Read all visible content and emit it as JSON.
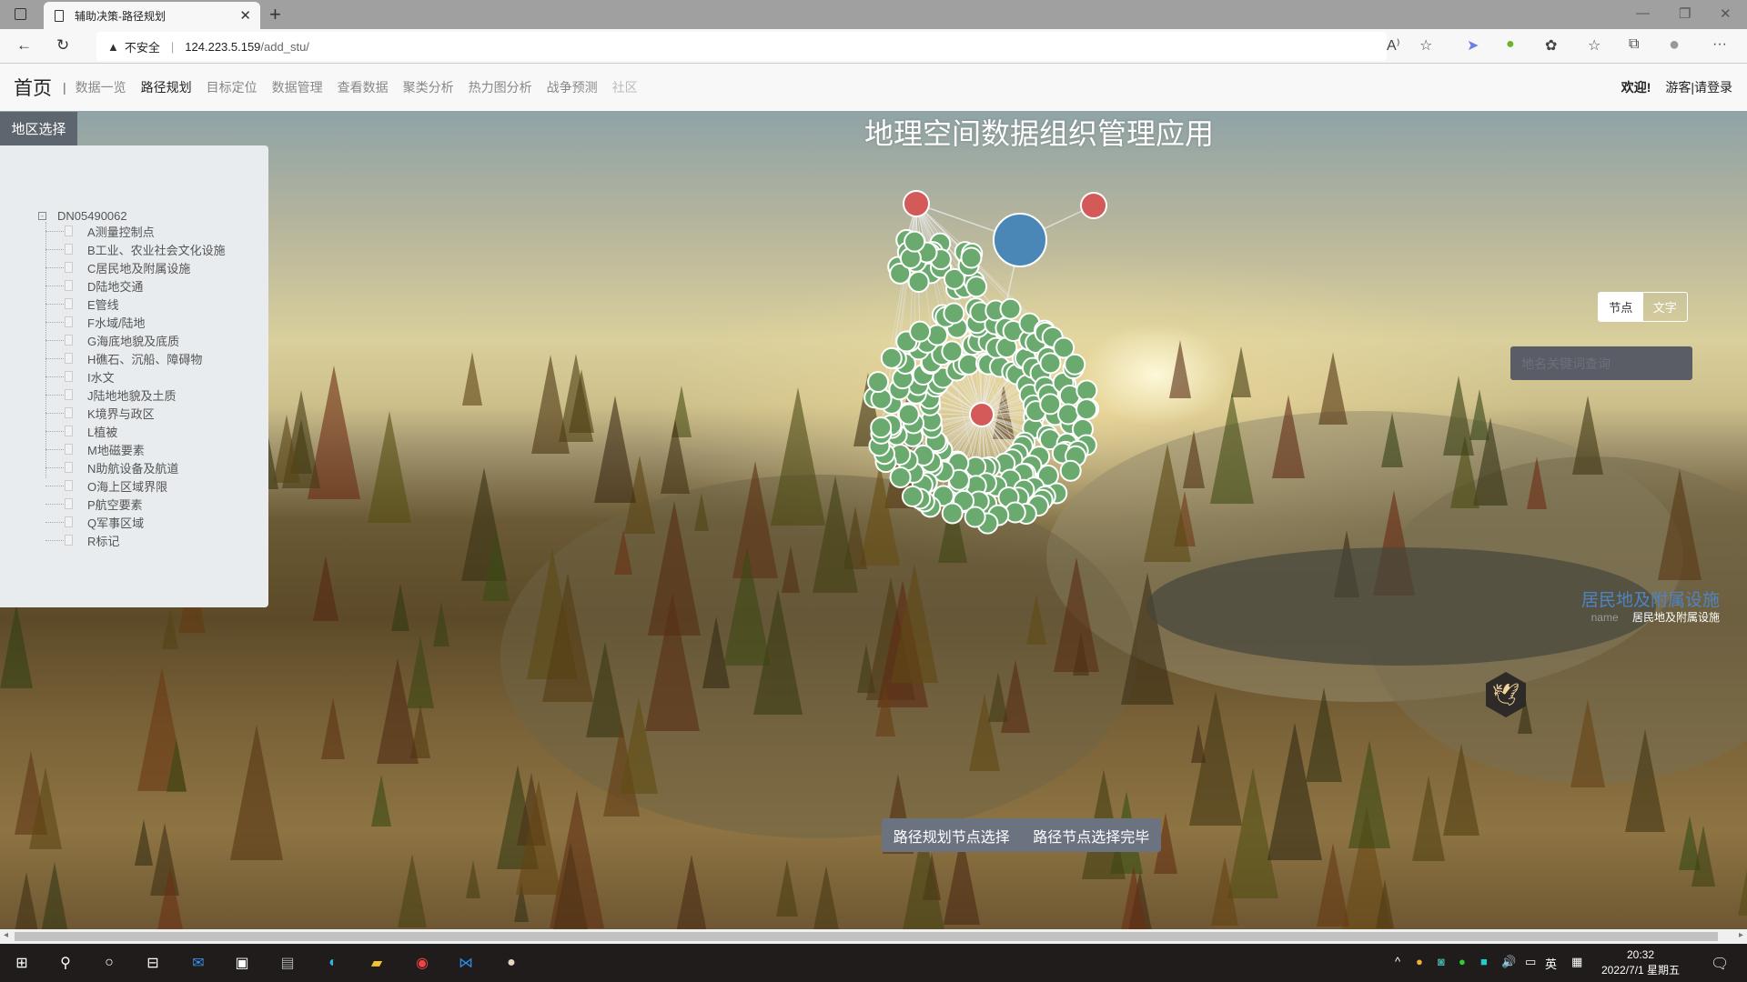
{
  "browser": {
    "tab_title": "辅助决策-路径规划",
    "security_label": "不安全",
    "url_host": "124.223.5.159",
    "url_path": "/add_stu/"
  },
  "nav": {
    "home": "首页",
    "separator": "|",
    "items": [
      {
        "label": "数据一览",
        "state": "normal"
      },
      {
        "label": "路径规划",
        "state": "active"
      },
      {
        "label": "目标定位",
        "state": "normal"
      },
      {
        "label": "数据管理",
        "state": "normal"
      },
      {
        "label": "查看数据",
        "state": "normal"
      },
      {
        "label": "聚类分析",
        "state": "normal"
      },
      {
        "label": "热力图分析",
        "state": "normal"
      },
      {
        "label": "战争预测",
        "state": "normal"
      },
      {
        "label": "社区",
        "state": "dim"
      }
    ],
    "welcome": "欢迎!",
    "login": "游客|请登录"
  },
  "page": {
    "title": "地理空间数据组织管理应用",
    "region_label": "地区选择",
    "tree": {
      "root": "DN05490062",
      "items": [
        "A测量控制点",
        "B工业、农业社会文化设施",
        "C居民地及附属设施",
        "D陆地交通",
        "E管线",
        "F水域/陆地",
        "G海底地貌及底质",
        "H礁石、沉船、障碍物",
        "I水文",
        "J陆地地貌及土质",
        "K境界与政区",
        "L植被",
        "M地磁要素",
        "N助航设备及航道",
        "O海上区域界限",
        "P航空要素",
        "Q军事区域",
        "R标记"
      ]
    },
    "toggle": {
      "node": "节点",
      "text": "文字",
      "selected": "节点"
    },
    "search_placeholder": "地名关键词查询",
    "info": {
      "title": "居民地及附属设施",
      "key": "name",
      "value": "居民地及附属设施"
    },
    "buttons": {
      "select": "路径规划节点选择",
      "done": "路径节点选择完毕"
    }
  },
  "graph": {
    "colors": {
      "leaf": "#6aaa6e",
      "hub": "#d45a5a",
      "root": "#4a86b6",
      "link": "#e8e8e8"
    }
  },
  "taskbar": {
    "time": "20:32",
    "date": "2022/7/1 星期五",
    "ime": "英"
  }
}
